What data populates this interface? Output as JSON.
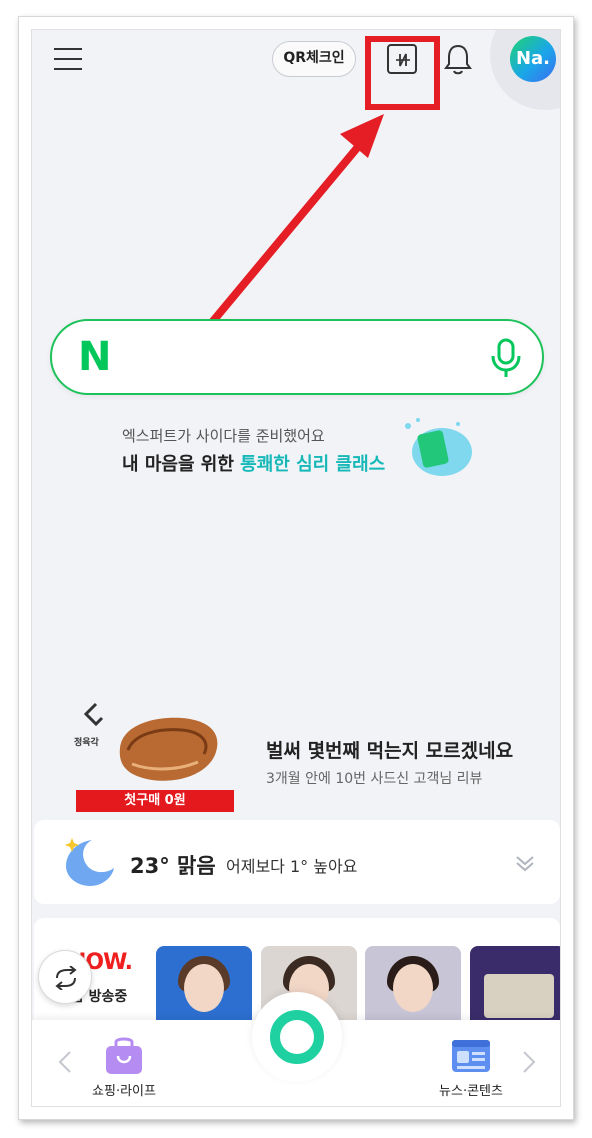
{
  "header": {
    "qr_label": "QR체크인",
    "avatar_text": "Na."
  },
  "search": {
    "logo_text": "N"
  },
  "promo": {
    "subtitle": "엑스퍼트가 사이다를 준비했어요",
    "title_prefix": "내 마음을 위한 ",
    "title_highlight": "통쾌한 심리 클래스"
  },
  "ad": {
    "brand": "정육각",
    "badge": "첫구매 0원",
    "title": "벌써 몇번째 먹는지 모르겠네요",
    "subtitle": "3개월 안에 10번 사드신 고객님 리뷰"
  },
  "weather": {
    "temperature": "23°",
    "condition": "맑음",
    "comparison": "어제보다 1° 높아요"
  },
  "now": {
    "logo": "NOW.",
    "label": "지금 방송중"
  },
  "bottom_nav": {
    "left_label": "쇼핑·라이프",
    "right_label": "뉴스·콘텐츠"
  },
  "colors": {
    "naver_green": "#03c75a",
    "highlight_red": "#e51d25",
    "accent_teal": "#16b8b8"
  }
}
